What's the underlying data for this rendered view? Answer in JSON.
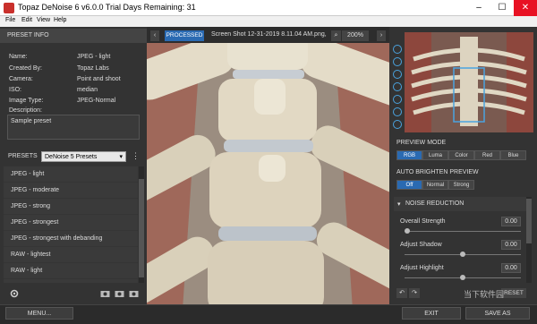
{
  "window": {
    "title": "Topaz DeNoise 6 v6.0.0    Trial Days Remaining: 31"
  },
  "menu": [
    "File",
    "Edit",
    "View",
    "Help"
  ],
  "preset_info": {
    "header": "PRESET INFO",
    "rows": [
      {
        "label": "Name:",
        "value": "JPEG - light"
      },
      {
        "label": "Created By:",
        "value": "Topaz Labs"
      },
      {
        "label": "Camera:",
        "value": "Point and shoot"
      },
      {
        "label": "ISO:",
        "value": "median"
      },
      {
        "label": "Image Type:",
        "value": "JPEG-Normal"
      },
      {
        "label": "Description:",
        "value": ""
      }
    ],
    "description": "Sample preset"
  },
  "presets": {
    "label": "PRESETS",
    "dropdown": "DeNoise 5 Presets",
    "items": [
      "JPEG - light",
      "JPEG - moderate",
      "JPEG - strong",
      "JPEG - strongest",
      "JPEG - strongest with debanding",
      "RAW - lightest",
      "RAW - light"
    ]
  },
  "view": {
    "mode": "PROCESSED",
    "filename": "Screen Shot 12-31-2019 8.11.04 AM.png,",
    "zoom": "200%"
  },
  "preview_mode": {
    "header": "PREVIEW MODE",
    "options": [
      "RGB",
      "Luma",
      "Color",
      "Red",
      "Blue"
    ],
    "selected": 0
  },
  "auto_brighten": {
    "header": "AUTO BRIGHTEN PREVIEW",
    "options": [
      "Off",
      "Normal",
      "Strong"
    ],
    "selected": 0
  },
  "noise_reduction": {
    "header": "NOISE REDUCTION",
    "params": [
      {
        "label": "Overall Strength",
        "value": "0.00",
        "level": 0.0
      },
      {
        "label": "Adjust Shadow",
        "value": "0.00",
        "level": 0.5
      },
      {
        "label": "Adjust Highlight",
        "value": "0.00",
        "level": 0.5
      }
    ],
    "reset": "RESET"
  },
  "bottom": {
    "menu": "MENU...",
    "exit": "EXIT",
    "save": "SAVE AS"
  },
  "watermark": "当下软件园"
}
